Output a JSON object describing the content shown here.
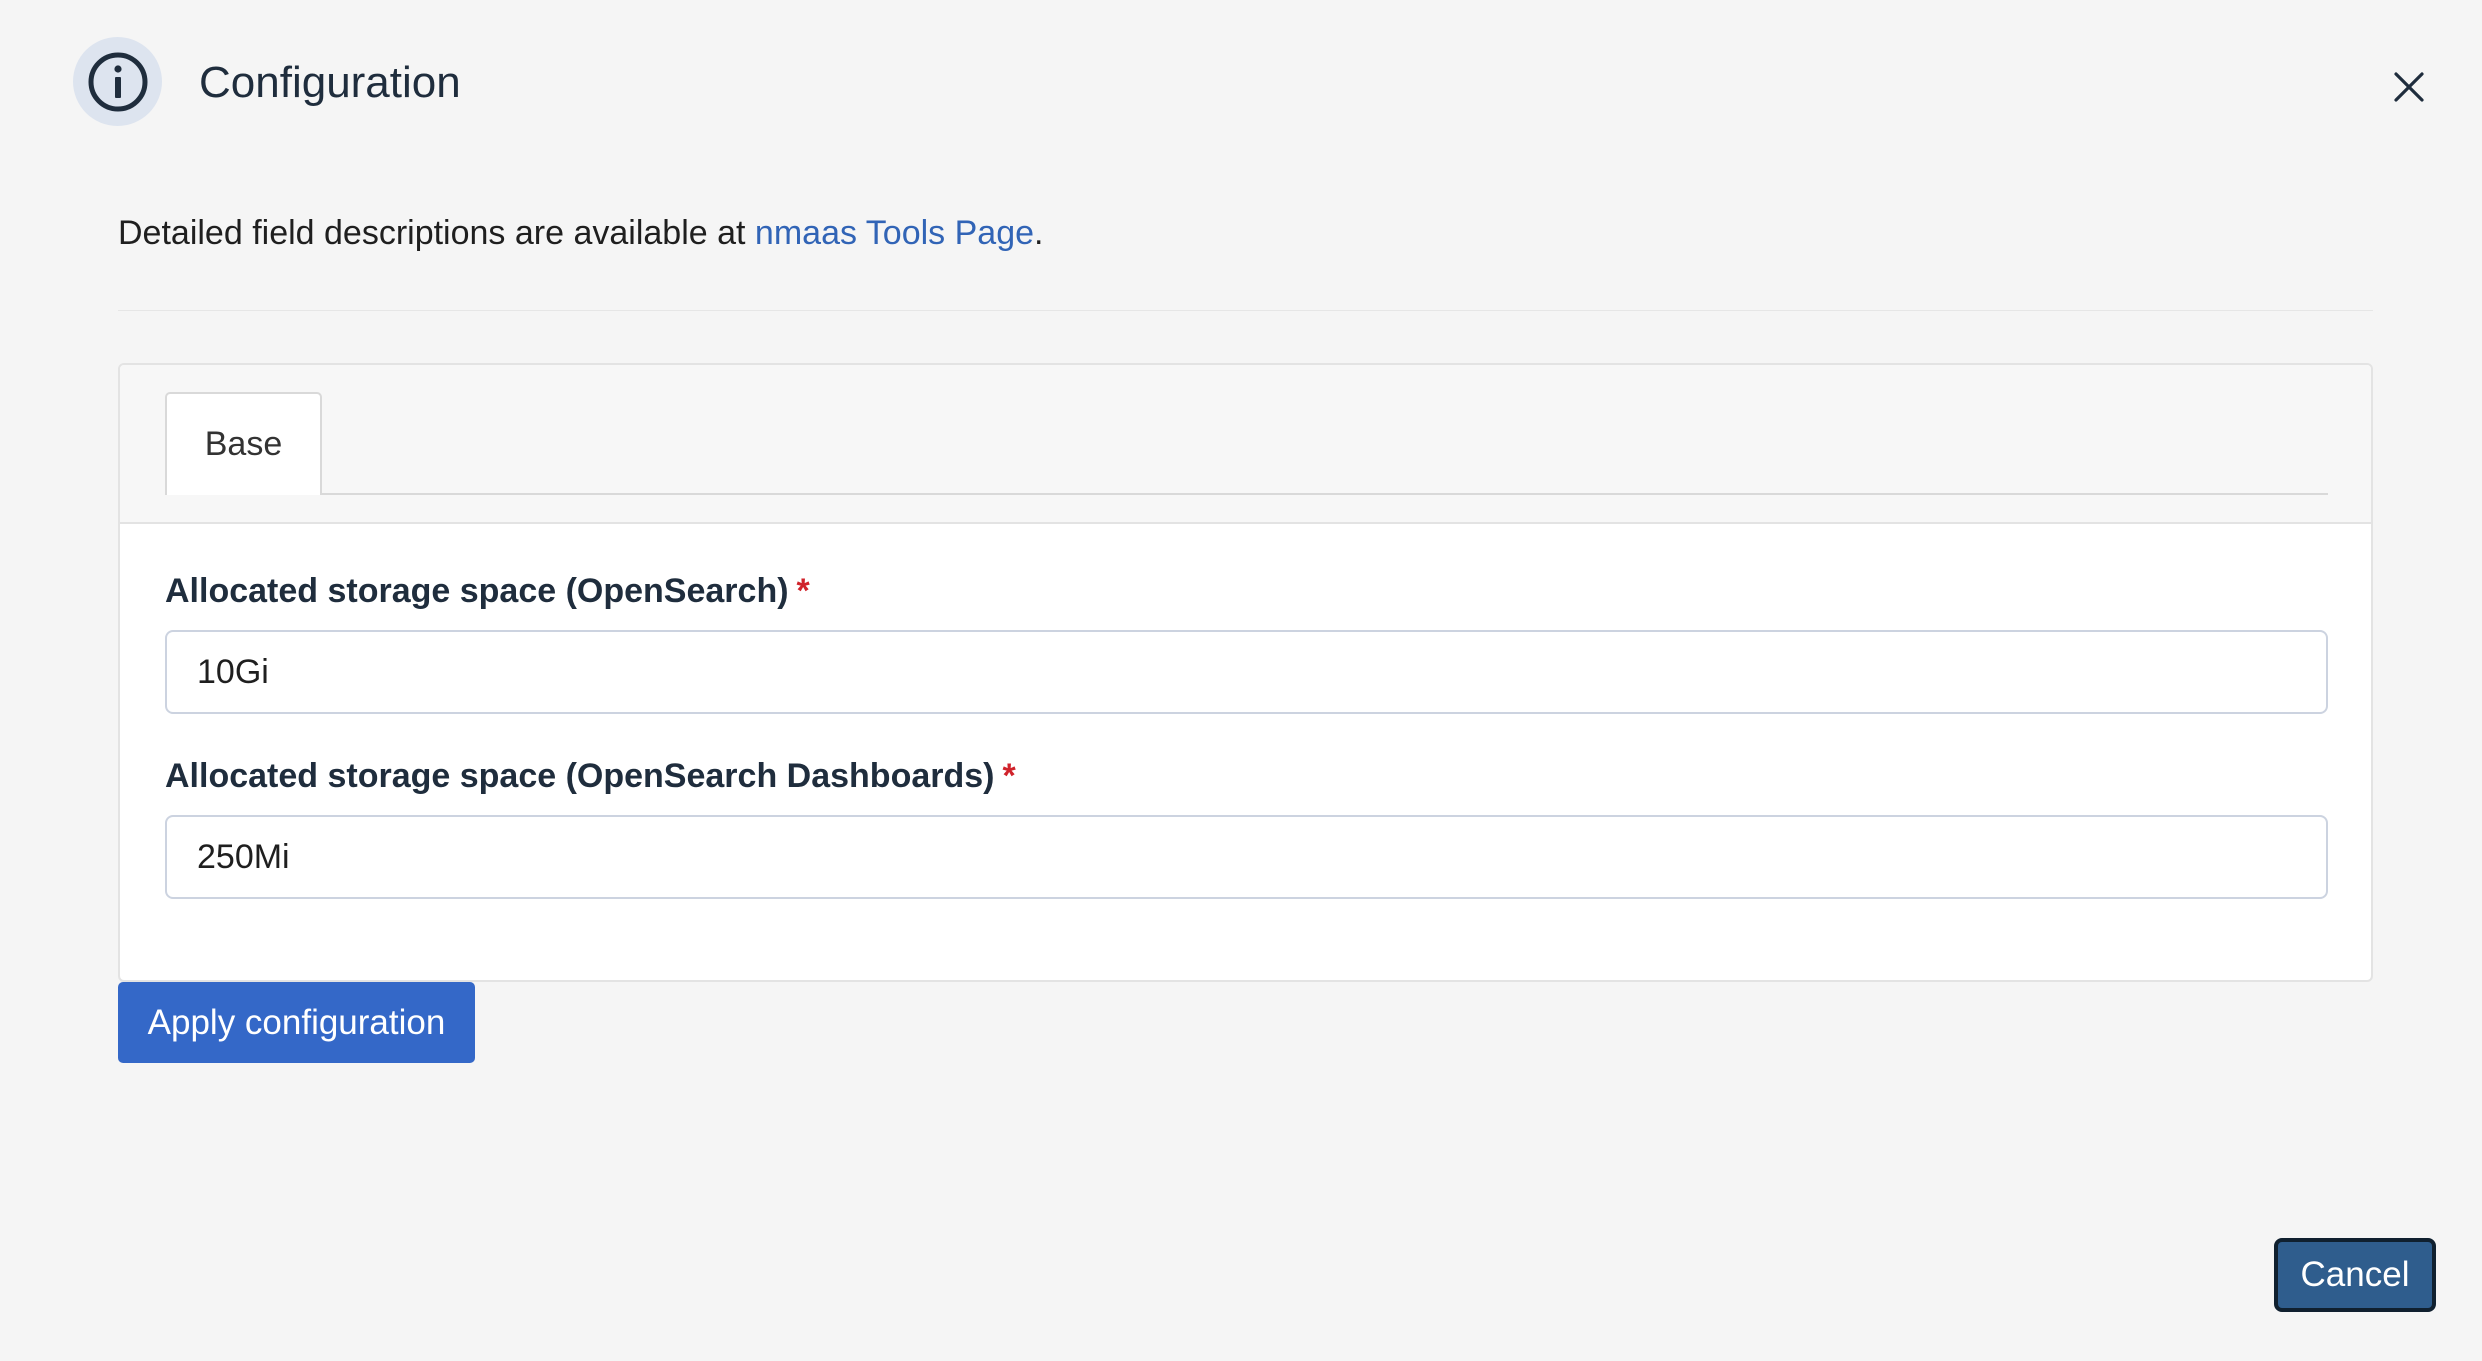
{
  "header": {
    "title": "Configuration",
    "info_icon": "info-circle-icon",
    "close_icon": "close-icon"
  },
  "description": {
    "text_before": "Detailed field descriptions are available at ",
    "link_text": "nmaas Tools Page",
    "text_after": "."
  },
  "tabs": [
    {
      "label": "Base",
      "active": true
    }
  ],
  "fields": [
    {
      "label": "Allocated storage space (OpenSearch)",
      "required_mark": "*",
      "value": "10Gi"
    },
    {
      "label": "Allocated storage space (OpenSearch Dashboards)",
      "required_mark": "*",
      "value": "250Mi"
    }
  ],
  "actions": {
    "apply_label": "Apply configuration",
    "cancel_label": "Cancel"
  },
  "colors": {
    "primary": "#3468c8",
    "link": "#3164b6",
    "required": "#d0232b",
    "cancel": "#2f5d8d"
  }
}
